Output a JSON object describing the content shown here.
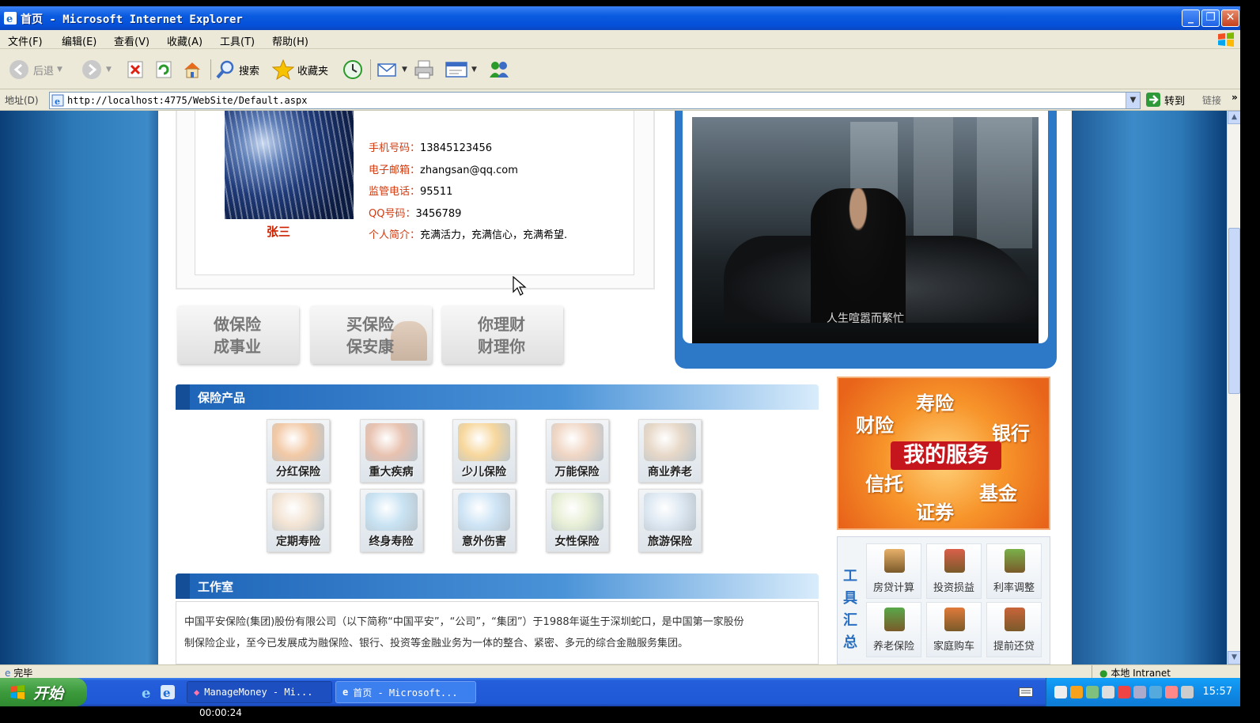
{
  "window": {
    "title": "首页 - Microsoft Internet Explorer"
  },
  "menubar": {
    "items": [
      "文件(F)",
      "编辑(E)",
      "查看(V)",
      "收藏(A)",
      "工具(T)",
      "帮助(H)"
    ]
  },
  "toolbar": {
    "back": "后退",
    "search": "搜索",
    "favorites": "收藏夹"
  },
  "address": {
    "label": "地址(D)",
    "url": "http://localhost:4775/WebSite/Default.aspx",
    "go": "转到",
    "links": "链接"
  },
  "profile": {
    "name": "张三",
    "fields": [
      {
        "key": "手机号码：",
        "value": "13845123456"
      },
      {
        "key": "电子邮箱：",
        "value": "zhangsan@qq.com"
      },
      {
        "key": "监管电话：",
        "value": "95511"
      },
      {
        "key": "QQ号码：",
        "value": "3456789"
      },
      {
        "key": "个人简介：",
        "value": "充满活力，充满信心，充满希望."
      }
    ]
  },
  "slogans": [
    {
      "line1": "做保险",
      "line2": "成事业"
    },
    {
      "line1": "买保险",
      "line2": "保安康"
    },
    {
      "line1": "你理财",
      "line2": "财理你"
    }
  ],
  "video": {
    "subtitle": "人生喧嚣而繁忙"
  },
  "products": {
    "title": "保险产品",
    "items": [
      "分红保险",
      "重大疾病",
      "少儿保险",
      "万能保险",
      "商业养老",
      "定期寿险",
      "终身寿险",
      "意外伤害",
      "女性保险",
      "旅游保险"
    ]
  },
  "studio": {
    "title": "工作室",
    "text_line1": "中国平安保险(集团)股份有限公司（以下简称“中国平安”，“公司”，“集团”）于1988年诞生于深圳蛇口，是中国第一家股份",
    "text_line2": "制保险企业，至今已发展成为融保险、银行、投资等金融业务为一体的整合、紧密、多元的综合金融服务集团。"
  },
  "ad": {
    "words": [
      "寿险",
      "财险",
      "银行",
      "信托",
      "基金",
      "证券"
    ],
    "main": "我的服务"
  },
  "tools": {
    "title": "工具汇总",
    "items": [
      "房贷计算",
      "投资损益",
      "利率调整",
      "养老保险",
      "家庭购车",
      "提前还贷"
    ]
  },
  "statusbar": {
    "status": "完毕",
    "zone": "本地 Intranet"
  },
  "taskbar": {
    "start": "开始",
    "tasks": [
      "ManageMoney - Mi...",
      "首页 - Microsoft..."
    ],
    "clock": "15:57"
  },
  "recording": {
    "timer": "00:00:24"
  }
}
